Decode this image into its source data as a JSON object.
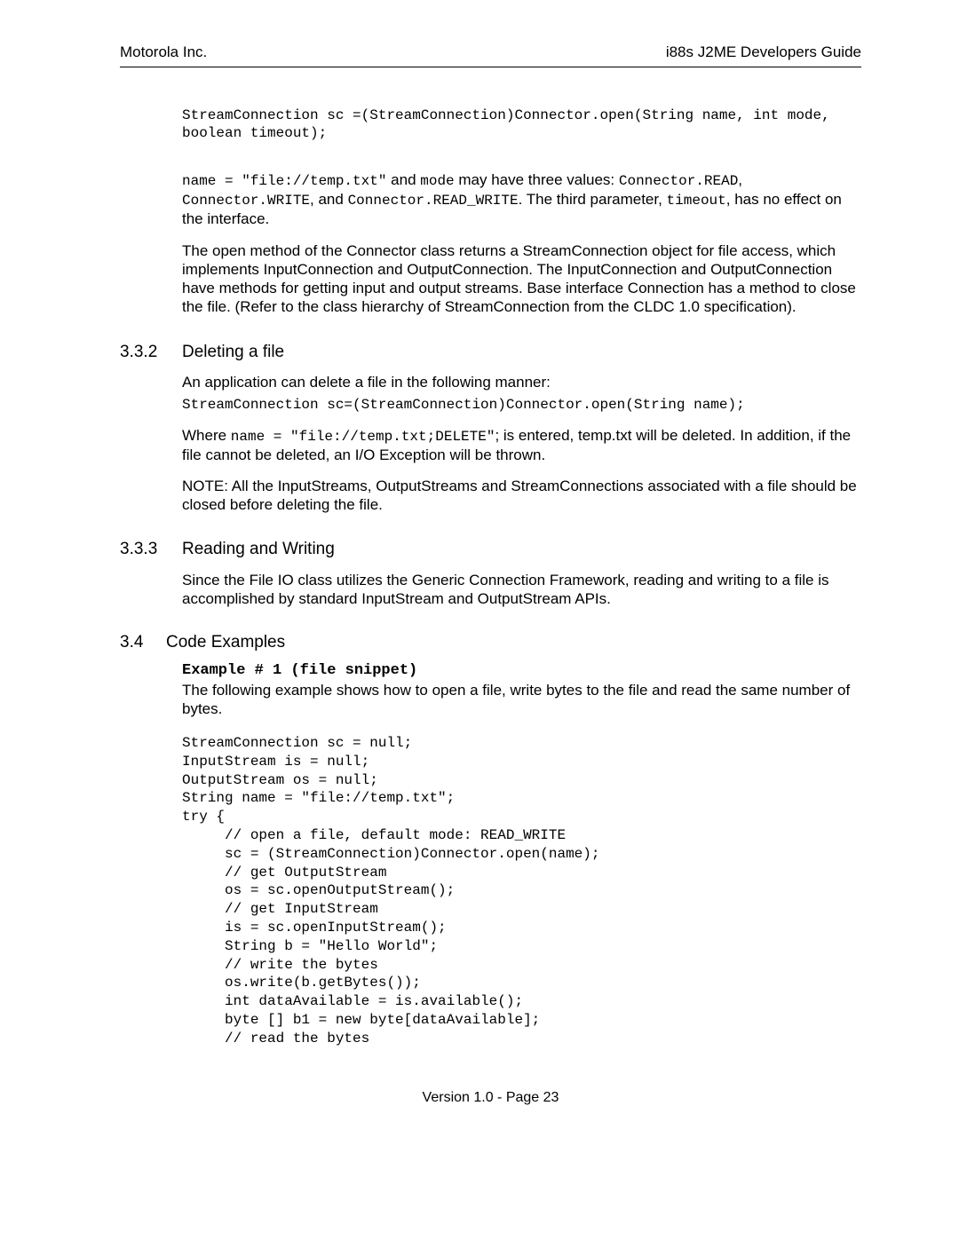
{
  "header": {
    "left": "Motorola Inc.",
    "right": "i88s J2ME Developers  Guide"
  },
  "intro": {
    "code1": "StreamConnection sc =(StreamConnection)Connector.open(String name, int mode, boolean timeout);",
    "p1": {
      "t1": "name = \"file://temp.txt\"",
      "t2": " and ",
      "t3": "mode",
      "t4": " may have three values: ",
      "t5": "Connector.READ",
      "t6": ", ",
      "t7": "Connector.WRITE",
      "t8": ", and ",
      "t9": " Connector.READ_WRITE",
      "t10": ". The third parameter, ",
      "t11": "timeout",
      "t12": ", has no effect on the interface."
    },
    "p2": "The open method of the Connector class returns a StreamConnection object for file access, which implements InputConnection and OutputConnection. The InputConnection and OutputConnection have methods for getting input and output streams. Base interface Connection has a method to close the file. (Refer to the class hierarchy of  StreamConnection from the CLDC 1.0 specification)."
  },
  "s332": {
    "num": "3.3.2",
    "title": "Deleting a file",
    "p1": "An application can delete a file in the following manner:",
    "code1": "StreamConnection sc=(StreamConnection)Connector.open(String name);",
    "p2": {
      "t1": "Where ",
      "t2": "name = \"file://temp.txt;DELETE\"",
      "t3": "; is entered,  temp.txt  will be deleted.  In addition, if the file cannot be deleted, an I/O Exception will be thrown."
    },
    "note": "NOTE:  All the InputStreams, OutputStreams and StreamConnections associated with a file should be closed before deleting the file."
  },
  "s333": {
    "num": "3.3.3",
    "title": "Reading and Writing",
    "p1": "Since the File IO class utilizes the Generic Connection Framework, reading and writing to a file is accomplished by standard InputStream and OutputStream APIs."
  },
  "s34": {
    "num": "3.4",
    "title": "Code Examples",
    "ex_title": "Example # 1 (file snippet)",
    "ex_desc": "The following example shows how to open a file, write bytes to the file and read the same number of bytes.",
    "code": "StreamConnection sc = null;\nInputStream is = null;\nOutputStream os = null;\nString name = \"file://temp.txt\";\ntry {\n     // open a file, default mode: READ_WRITE\n     sc = (StreamConnection)Connector.open(name);\n     // get OutputStream\n     os = sc.openOutputStream();\n     // get InputStream\n     is = sc.openInputStream();\n     String b = \"Hello World\";\n     // write the bytes\n     os.write(b.getBytes());\n     int dataAvailable = is.available();\n     byte [] b1 = new byte[dataAvailable];\n     // read the bytes"
  },
  "footer": "Version 1.0 - Page 23"
}
